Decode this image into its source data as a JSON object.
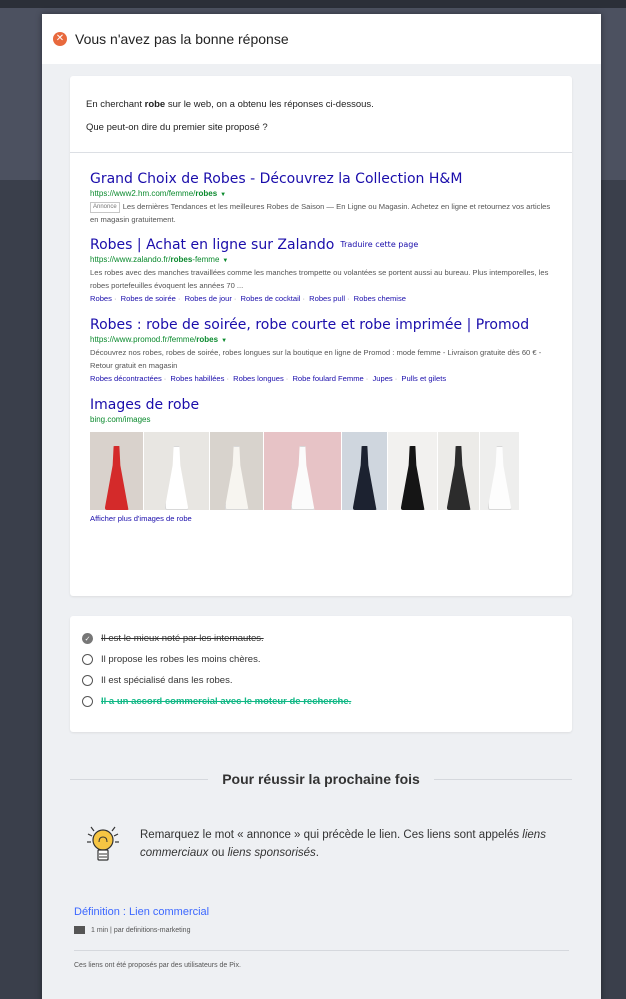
{
  "modal": {
    "title": "Vous n'avez pas la bonne réponse"
  },
  "question": {
    "line1_pre": "En cherchant ",
    "line1_bold": "robe",
    "line1_post": " sur le web, on a obtenu les réponses ci-dessous.",
    "line2": "Que peut-on dire du premier site proposé ?"
  },
  "serp": {
    "results": [
      {
        "title": "Grand Choix de Robes - Découvrez la Collection H&M",
        "url_pre": "https://www2.hm.com/femme/",
        "url_bold": "robes",
        "badge": "Annonce",
        "desc": "Les dernières Tendances et les meilleures Robes de Saison — En Ligne ou Magasin. Achetez en ligne et retournez vos articles en magasin gratuitement."
      },
      {
        "title": "Robes | Achat en ligne sur Zalando",
        "translate": "Traduire cette page",
        "url_pre": "https://www.zalando.fr/",
        "url_bold": "robes",
        "url_post": "-femme",
        "desc": "Les robes avec des manches travaillées comme les manches trompette ou volantées se portent aussi au bureau. Plus intemporelles, les robes portefeuilles évoquent les années 70 ...",
        "links": [
          "Robes",
          "Robes de soirée",
          "Robes de jour",
          "Robes de cocktail",
          "Robes pull",
          "Robes chemise"
        ]
      },
      {
        "title": "Robes : robe de soirée, robe courte et robe imprimée | Promod",
        "url_pre": "https://www.promod.fr/femme/",
        "url_bold": "robes",
        "desc": "Découvrez nos robes, robes de soirée, robes longues sur la boutique en ligne de Promod : mode femme - Livraison gratuite dès 60 € - Retour gratuit en magasin",
        "links": [
          "Robes décontractées",
          "Robes habillées",
          "Robes longues",
          "Robe foulard Femme",
          "Jupes",
          "Pulls et gilets"
        ]
      }
    ],
    "images": {
      "title": "Images de robe",
      "source": "bing.com/images",
      "more": "Afficher plus d'images de robe",
      "thumbs": [
        {
          "bg": "#d9d2cc",
          "dress": "#d42a2a",
          "w": 54
        },
        {
          "bg": "#e8e6e2",
          "dress": "#ffffff",
          "w": 66
        },
        {
          "bg": "#d8d3cd",
          "dress": "#f7f5f0",
          "w": 54
        },
        {
          "bg": "#e7c3c6",
          "dress": "#fbfbfb",
          "w": 78
        },
        {
          "bg": "#cfd6de",
          "dress": "#1c2230",
          "w": 46
        },
        {
          "bg": "#f2f1ef",
          "dress": "#151515",
          "w": 50
        },
        {
          "bg": "#ecebe8",
          "dress": "#2c2c2c",
          "w": 42
        },
        {
          "bg": "#eeeeed",
          "dress": "#fdfdfd",
          "w": 40
        }
      ]
    }
  },
  "answers": [
    {
      "label": "Il est le mieux noté par les internautes.",
      "state": "wrong"
    },
    {
      "label": "Il propose les robes les moins chères.",
      "state": "none"
    },
    {
      "label": "Il est spécialisé dans les robes.",
      "state": "none"
    },
    {
      "label": "Il a un accord commercial avec le moteur de recherche.",
      "state": "correct"
    }
  ],
  "tips": {
    "heading": "Pour réussir la prochaine fois",
    "text_pre": "Remarquez le mot « annonce » qui précède le lien. Ces liens sont appelés ",
    "text_i1": "liens commerciaux",
    "text_mid": " ou ",
    "text_i2": "liens sponsorisés",
    "text_post": "."
  },
  "learning": {
    "link": "Définition : Lien commercial",
    "meta": "1 min  |  par definitions-marketing",
    "note": "Ces liens ont été proposés par des utilisateurs de Pix."
  },
  "colors": {
    "error": "#e8693d",
    "correct": "#12b886",
    "link": "#1a0dab",
    "url": "#0a8a2d",
    "accent": "#3d68ff"
  }
}
